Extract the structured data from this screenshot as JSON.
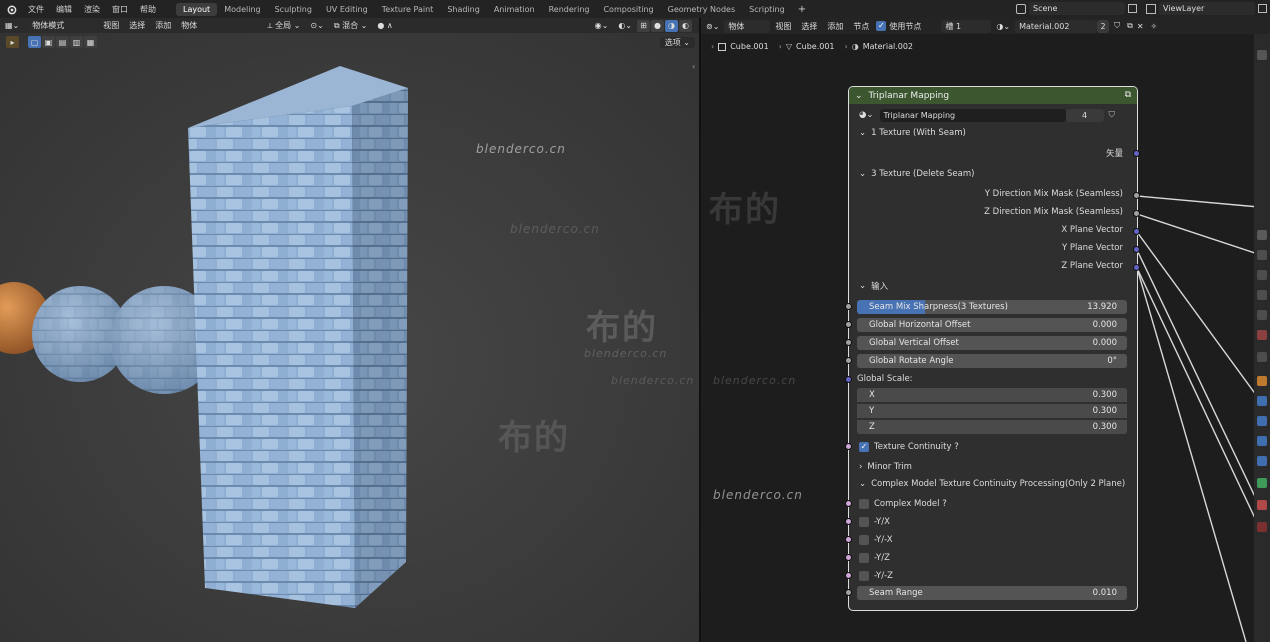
{
  "app": {
    "menus": [
      "文件",
      "编辑",
      "渲染",
      "窗口",
      "帮助"
    ],
    "workspaces": [
      "Layout",
      "Modeling",
      "Sculpting",
      "UV Editing",
      "Texture Paint",
      "Shading",
      "Animation",
      "Rendering",
      "Compositing",
      "Geometry Nodes",
      "Scripting"
    ],
    "active_workspace": "Layout",
    "add_tab": "+",
    "scene": "Scene",
    "view_layer": "ViewLayer"
  },
  "viewport": {
    "mode": "物体模式",
    "menus": [
      "视图",
      "选择",
      "添加",
      "物体"
    ],
    "transform": "全局",
    "snap": "混合",
    "options": "选项",
    "watermarks": [
      "blenderco.cn",
      "blenderco.cn",
      "blenderco.cn",
      "blenderco.cn"
    ],
    "watermark_big": [
      "布的",
      "布的"
    ]
  },
  "node_editor": {
    "type": "物体",
    "menus": [
      "视图",
      "选择",
      "添加",
      "节点"
    ],
    "use_nodes": "使用节点",
    "slot": "槽 1",
    "material": "Material.002",
    "users": "2",
    "breadcrumb": [
      "Cube.001",
      "Cube.001",
      "Material.002"
    ],
    "watermarks": [
      "blenderco.cn",
      "blenderco.cn"
    ],
    "watermark_big": "布的"
  },
  "node": {
    "title": "Triplanar Mapping",
    "group_name": "Triplanar Mapping",
    "group_users": "4",
    "panel1": "1 Texture (With Seam)",
    "out_vector": "矢量",
    "panel2": "3 Texture (Delete Seam)",
    "outputs": [
      "Y Direction Mix Mask (Seamless)",
      "Z Direction Mix Mask (Seamless)",
      "X Plane Vector",
      "Y Plane Vector",
      "Z Plane Vector"
    ],
    "panel_input": "输入",
    "sliders": [
      {
        "label": "Seam Mix Sharpness(3 Textures)",
        "value": "13.920",
        "fill": 0.25
      },
      {
        "label": "Global Horizontal Offset",
        "value": "0.000",
        "fill": 0
      },
      {
        "label": "Global Vertical Offset",
        "value": "0.000",
        "fill": 0
      },
      {
        "label": "Global Rotate Angle",
        "value": "0°",
        "fill": 0
      }
    ],
    "global_scale": "Global Scale:",
    "scale": [
      {
        "label": "X",
        "value": "0.300"
      },
      {
        "label": "Y",
        "value": "0.300"
      },
      {
        "label": "Z",
        "value": "0.300"
      }
    ],
    "texture_continuity": "Texture Continuity ?",
    "minor_trim": "Minor Trim",
    "complex_panel": "Complex Model Texture Continuity Processing(Only 2 Plane)",
    "checks": [
      "Complex Model ?",
      "-Y/X",
      "-Y/-X",
      "-Y/Z",
      "-Y/-Z"
    ],
    "seam_range": {
      "label": "Seam Range",
      "value": "0.010"
    }
  },
  "colors": {
    "node_header": "#3c5630",
    "accent": "#4772b3",
    "socket_grey": "#a1a1a1",
    "socket_purple": "#6363c7",
    "socket_pink": "#cca6d6"
  }
}
